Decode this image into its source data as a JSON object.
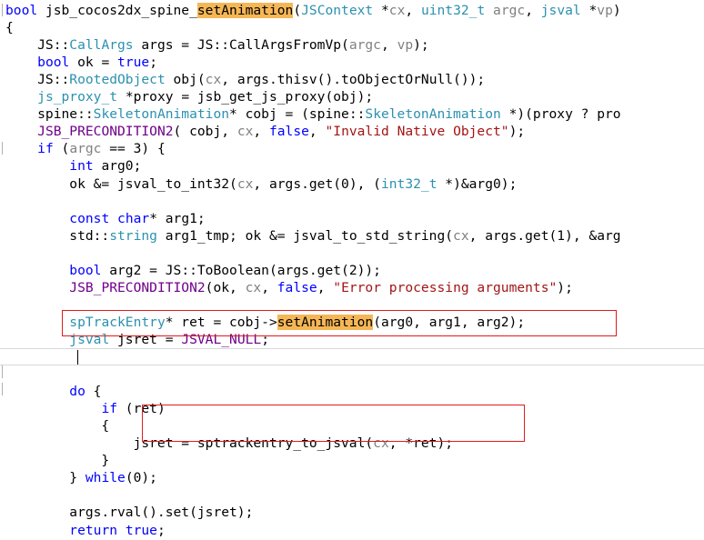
{
  "lines": [
    [
      [
        "kw",
        "bool"
      ],
      [
        "plain",
        " jsb_cocos2dx_spine_"
      ],
      [
        "hl",
        "setAnimation"
      ],
      [
        "plain",
        "("
      ],
      [
        "ty",
        "JSContext"
      ],
      [
        "plain",
        " *"
      ],
      [
        "par",
        "cx"
      ],
      [
        "plain",
        ", "
      ],
      [
        "ty",
        "uint32_t"
      ],
      [
        "plain",
        " "
      ],
      [
        "par",
        "argc"
      ],
      [
        "plain",
        ", "
      ],
      [
        "ty",
        "jsval"
      ],
      [
        "plain",
        " *"
      ],
      [
        "par",
        "vp"
      ],
      [
        "plain",
        ")"
      ]
    ],
    [
      [
        "plain",
        "{"
      ]
    ],
    [
      [
        "plain",
        "    JS::"
      ],
      [
        "ty",
        "CallArgs"
      ],
      [
        "plain",
        " args = JS::CallArgsFromVp("
      ],
      [
        "par",
        "argc"
      ],
      [
        "plain",
        ", "
      ],
      [
        "par",
        "vp"
      ],
      [
        "plain",
        ");"
      ]
    ],
    [
      [
        "plain",
        "    "
      ],
      [
        "kw",
        "bool"
      ],
      [
        "plain",
        " ok = "
      ],
      [
        "kw",
        "true"
      ],
      [
        "plain",
        ";"
      ]
    ],
    [
      [
        "plain",
        "    JS::"
      ],
      [
        "ty",
        "RootedObject"
      ],
      [
        "plain",
        " obj("
      ],
      [
        "par",
        "cx"
      ],
      [
        "plain",
        ", args.thisv().toObjectOrNull());"
      ]
    ],
    [
      [
        "plain",
        "    "
      ],
      [
        "ty",
        "js_proxy_t"
      ],
      [
        "plain",
        " *proxy = jsb_get_js_proxy(obj);"
      ]
    ],
    [
      [
        "plain",
        "    spine::"
      ],
      [
        "ty",
        "SkeletonAnimation"
      ],
      [
        "plain",
        "* cobj = (spine::"
      ],
      [
        "ty",
        "SkeletonAnimation"
      ],
      [
        "plain",
        " *)(proxy ? pro"
      ]
    ],
    [
      [
        "plain",
        "    "
      ],
      [
        "mac",
        "JSB_PRECONDITION2"
      ],
      [
        "plain",
        "( cobj, "
      ],
      [
        "par",
        "cx"
      ],
      [
        "plain",
        ", "
      ],
      [
        "kw",
        "false"
      ],
      [
        "plain",
        ", "
      ],
      [
        "str",
        "\"Invalid Native Object\""
      ],
      [
        "plain",
        ");"
      ]
    ],
    [
      [
        "plain",
        "    "
      ],
      [
        "kw",
        "if"
      ],
      [
        "plain",
        " ("
      ],
      [
        "par",
        "argc"
      ],
      [
        "plain",
        " == 3) {"
      ]
    ],
    [
      [
        "plain",
        "        "
      ],
      [
        "kw",
        "int"
      ],
      [
        "plain",
        " arg0;"
      ]
    ],
    [
      [
        "plain",
        "        ok &= jsval_to_int32("
      ],
      [
        "par",
        "cx"
      ],
      [
        "plain",
        ", args.get(0), ("
      ],
      [
        "ty",
        "int32_t"
      ],
      [
        "plain",
        " *)&arg0);"
      ]
    ],
    [],
    [
      [
        "plain",
        "        "
      ],
      [
        "kw",
        "const"
      ],
      [
        "plain",
        " "
      ],
      [
        "kw",
        "char"
      ],
      [
        "plain",
        "* arg1;"
      ]
    ],
    [
      [
        "plain",
        "        std::"
      ],
      [
        "ty",
        "string"
      ],
      [
        "plain",
        " arg1_tmp; ok &= jsval_to_std_string("
      ],
      [
        "par",
        "cx"
      ],
      [
        "plain",
        ", args.get(1), &arg"
      ]
    ],
    [],
    [
      [
        "plain",
        "        "
      ],
      [
        "kw",
        "bool"
      ],
      [
        "plain",
        " arg2 = JS::ToBoolean(args.get(2));"
      ]
    ],
    [
      [
        "plain",
        "        "
      ],
      [
        "mac",
        "JSB_PRECONDITION2"
      ],
      [
        "plain",
        "(ok, "
      ],
      [
        "par",
        "cx"
      ],
      [
        "plain",
        ", "
      ],
      [
        "kw",
        "false"
      ],
      [
        "plain",
        ", "
      ],
      [
        "str",
        "\"Error processing arguments\""
      ],
      [
        "plain",
        ");"
      ]
    ],
    [],
    [
      [
        "plain",
        "        "
      ],
      [
        "ty",
        "spTrackEntry"
      ],
      [
        "plain",
        "* ret = cobj->"
      ],
      [
        "hl",
        "setAnimation"
      ],
      [
        "plain",
        "(arg0, arg1, arg2);"
      ]
    ],
    [
      [
        "plain",
        "        "
      ],
      [
        "ty",
        "jsval"
      ],
      [
        "plain",
        " jsret = "
      ],
      [
        "mac",
        "JSVAL_NULL"
      ],
      [
        "plain",
        ";"
      ]
    ],
    [],
    [],
    [
      [
        "plain",
        "        "
      ],
      [
        "kw",
        "do"
      ],
      [
        "plain",
        " {"
      ]
    ],
    [
      [
        "plain",
        "            "
      ],
      [
        "kw",
        "if"
      ],
      [
        "plain",
        " (ret)"
      ]
    ],
    [
      [
        "plain",
        "            {"
      ]
    ],
    [
      [
        "plain",
        "                jsret = sptrackentry_to_jsval("
      ],
      [
        "par",
        "cx"
      ],
      [
        "plain",
        ", *ret);"
      ]
    ],
    [
      [
        "plain",
        "            }"
      ]
    ],
    [
      [
        "plain",
        "        } "
      ],
      [
        "kw",
        "while"
      ],
      [
        "plain",
        "(0);"
      ]
    ],
    [],
    [
      [
        "plain",
        "        args.rval().set(jsret);"
      ]
    ],
    [
      [
        "plain",
        "        "
      ],
      [
        "kw",
        "return"
      ],
      [
        "plain",
        " "
      ],
      [
        "kw",
        "true"
      ],
      [
        "plain",
        ";"
      ]
    ],
    [
      [
        "plain",
        "    }"
      ]
    ]
  ]
}
